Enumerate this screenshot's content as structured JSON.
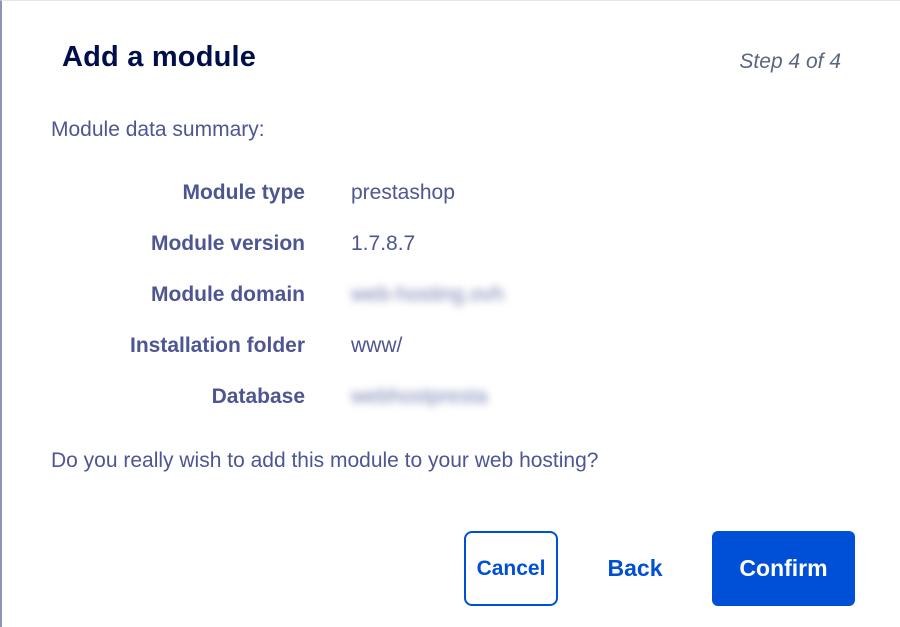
{
  "dialog": {
    "title": "Add a module",
    "step": "Step 4 of 4",
    "summary_label": "Module data summary:",
    "rows": [
      {
        "key": "Module type",
        "value": "prestashop",
        "blurred": false
      },
      {
        "key": "Module version",
        "value": "1.7.8.7",
        "blurred": false
      },
      {
        "key": "Module domain",
        "value": "web-hosting.ovh",
        "blurred": true
      },
      {
        "key": "Installation folder",
        "value": "www/",
        "blurred": false
      },
      {
        "key": "Database",
        "value": "webhostpresta",
        "blurred": true
      }
    ],
    "question": "Do you really wish to add this module to your web hosting?",
    "buttons": {
      "cancel": "Cancel",
      "back": "Back",
      "confirm": "Confirm"
    }
  },
  "colors": {
    "primary": "#0050d7",
    "title": "#000e4a",
    "text": "#4d5693",
    "step": "#5a6680"
  }
}
